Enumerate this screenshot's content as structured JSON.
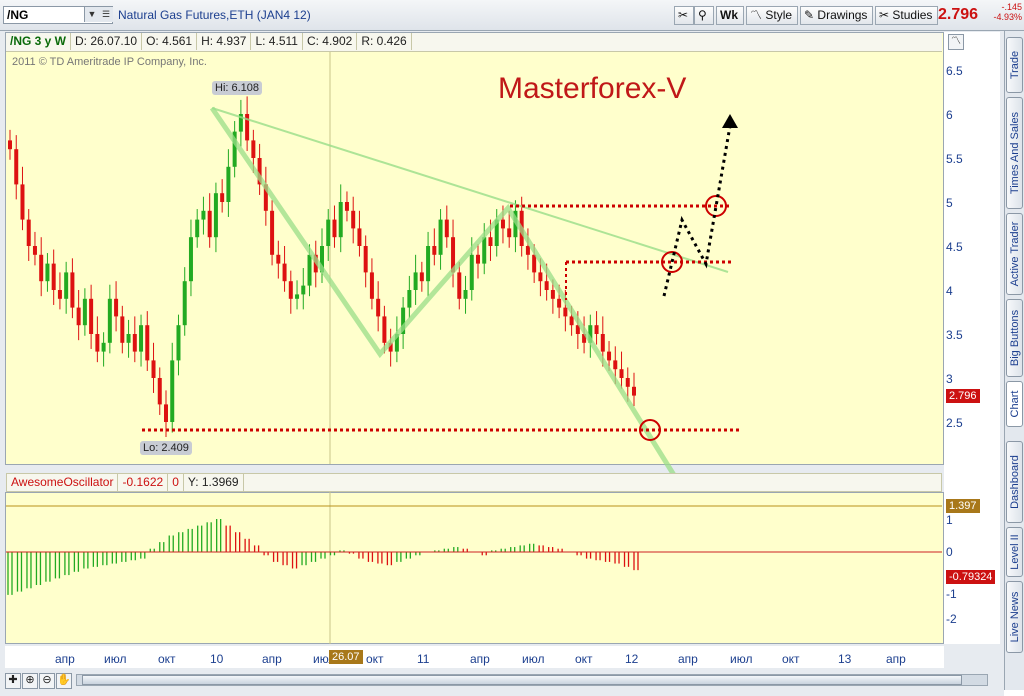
{
  "toolbar": {
    "symbol": "/NG",
    "contract": "Natural Gas Futures,ETH (JAN4 12)",
    "wk_label": "Wk",
    "style_label": "Style",
    "drawings_label": "Drawings",
    "studies_label": "Studies",
    "last_price": "2.796",
    "change": "-.145",
    "change_pct": "-4.93%"
  },
  "info": {
    "period": "/NG 3 y W",
    "date": "D: 26.07.10",
    "open": "O: 4.561",
    "high": "H: 4.937",
    "low": "L: 4.511",
    "close": "C: 4.902",
    "range": "R: 0.426"
  },
  "copyright": "2011 © TD Ameritrade IP Company, Inc.",
  "watermark": "Masterforex-V",
  "hi_label": "Hi: 6.108",
  "lo_label": "Lo: 2.409",
  "price_tag": "2.796",
  "osc": {
    "name": "AwesomeOscillator",
    "value": "-0.1622",
    "zero": "0",
    "y": "Y: 1.3969",
    "upper_tag": "1.397",
    "lower_tag": "-0.79324"
  },
  "date_cursor": "26.07",
  "price_axis": [
    "6.5",
    "6",
    "5.5",
    "5",
    "4.5",
    "4",
    "3.5",
    "3",
    "2.5"
  ],
  "osc_axis": [
    "1",
    "0",
    "-1",
    "-2"
  ],
  "time_axis": [
    "апр",
    "июл",
    "окт",
    "10",
    "апр",
    "июл",
    "окт",
    "11",
    "апр",
    "июл",
    "окт",
    "12",
    "апр",
    "июл",
    "окт",
    "13",
    "апр"
  ],
  "sidebar_tabs": [
    "Trade",
    "Times And Sales",
    "Active Trader",
    "Big Buttons",
    "Chart",
    "Dashboard",
    "Level II",
    "Live News"
  ],
  "colors": {
    "up": "#22aa22",
    "down": "#dd1111",
    "panel": "#ffffcc",
    "watermark": "#c01818",
    "level": "#cc0000"
  },
  "chart_data": {
    "type": "candlestick",
    "period": "weekly",
    "start": "2009-01",
    "price_range": [
      2.1,
      6.75
    ],
    "hi": 6.108,
    "lo": 2.409,
    "last": 2.796,
    "closes": [
      5.6,
      5.2,
      4.8,
      4.5,
      4.4,
      4.1,
      4.3,
      4.0,
      3.9,
      4.2,
      3.8,
      3.6,
      3.9,
      3.5,
      3.3,
      3.4,
      3.9,
      3.7,
      3.4,
      3.5,
      3.3,
      3.6,
      3.2,
      3.0,
      2.7,
      2.5,
      3.2,
      3.6,
      4.1,
      4.6,
      4.8,
      4.9,
      4.6,
      5.1,
      5.0,
      5.4,
      5.8,
      6.0,
      5.7,
      5.5,
      5.2,
      4.9,
      4.4,
      4.3,
      4.1,
      3.9,
      3.95,
      4.05,
      4.4,
      4.2,
      4.5,
      4.8,
      4.6,
      5.0,
      4.9,
      4.7,
      4.5,
      4.2,
      3.9,
      3.7,
      3.4,
      3.3,
      3.5,
      3.8,
      4.0,
      4.2,
      4.1,
      4.5,
      4.4,
      4.8,
      4.6,
      4.2,
      3.9,
      4.0,
      4.4,
      4.3,
      4.6,
      4.5,
      4.8,
      4.7,
      4.6,
      4.9,
      4.5,
      4.4,
      4.2,
      4.1,
      4.0,
      3.9,
      3.8,
      3.7,
      3.6,
      3.5,
      3.4,
      3.6,
      3.5,
      3.3,
      3.2,
      3.1,
      3.0,
      2.9,
      2.8
    ],
    "osc_values": [
      -1.3,
      -1.2,
      -1.1,
      -1.0,
      -0.9,
      -0.8,
      -0.7,
      -0.6,
      -0.5,
      -0.45,
      -0.4,
      -0.35,
      -0.3,
      -0.25,
      -0.2,
      0.1,
      0.3,
      0.5,
      0.6,
      0.7,
      0.8,
      0.9,
      1.0,
      0.8,
      0.6,
      0.4,
      0.2,
      -0.1,
      -0.3,
      -0.4,
      -0.5,
      -0.4,
      -0.3,
      -0.2,
      -0.1,
      0.05,
      -0.05,
      -0.2,
      -0.3,
      -0.35,
      -0.4,
      -0.3,
      -0.2,
      -0.1,
      0.0,
      0.05,
      0.1,
      0.15,
      0.1,
      0.0,
      -0.1,
      0.05,
      0.1,
      0.15,
      0.2,
      0.25,
      0.2,
      0.15,
      0.1,
      0.0,
      -0.1,
      -0.2,
      -0.25,
      -0.3,
      -0.35,
      -0.45,
      -0.55
    ]
  }
}
